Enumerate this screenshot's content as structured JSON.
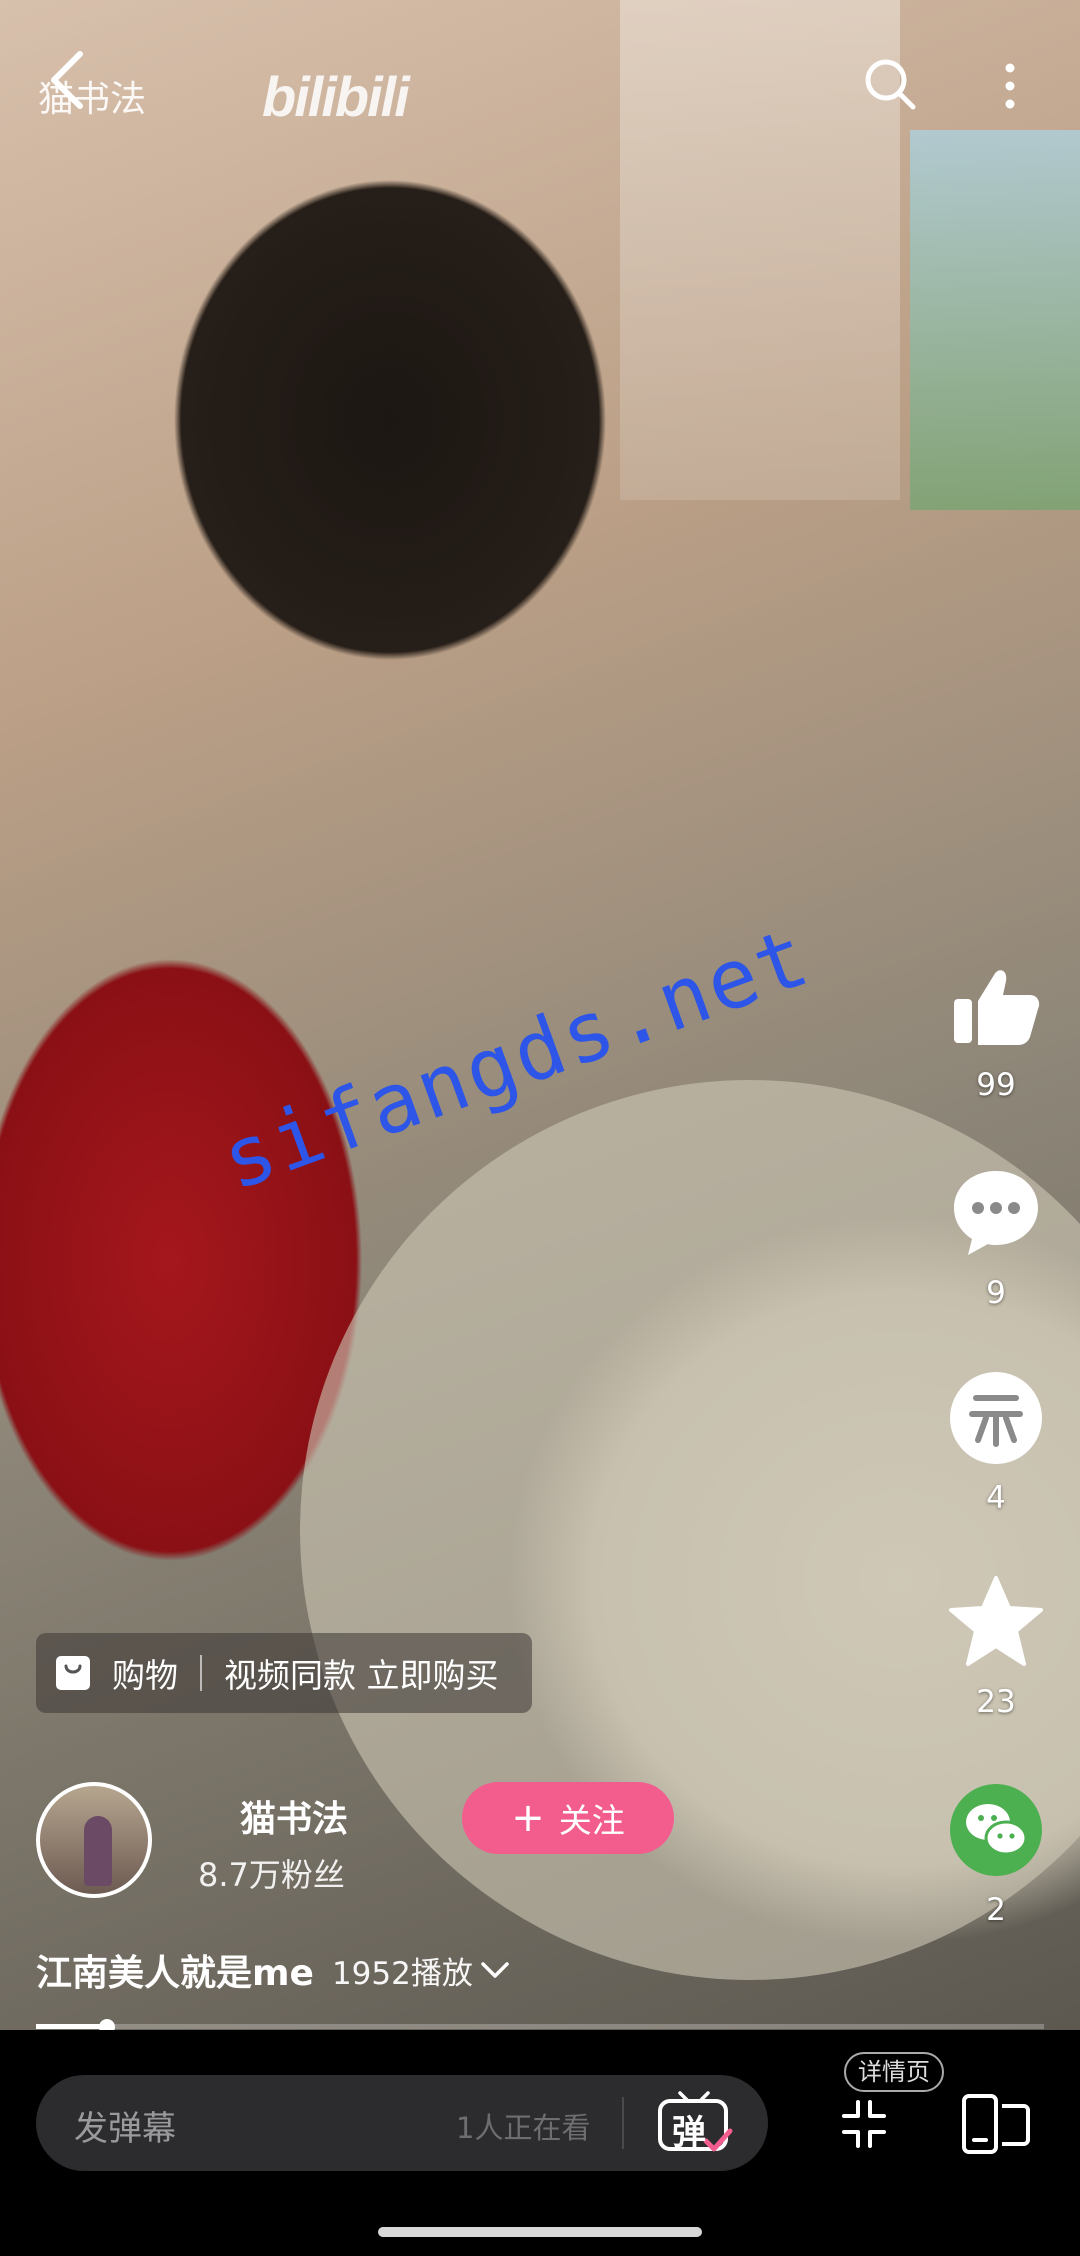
{
  "header": {
    "channel_name": "猫书法",
    "brand": "bilibili",
    "back_icon": "chevron-left-icon",
    "search_icon": "search-icon",
    "more_icon": "more-vertical-icon"
  },
  "watermark": "sifangds.net",
  "actions": {
    "like": {
      "icon": "thumbs-up-icon",
      "count": "99"
    },
    "comment": {
      "icon": "comment-bubble-icon",
      "count": "9"
    },
    "coin": {
      "icon": "coin-icon",
      "count": "4"
    },
    "favorite": {
      "icon": "star-icon",
      "count": "23"
    },
    "share": {
      "icon": "wechat-icon",
      "count": "2",
      "color": "#4CAF50"
    }
  },
  "shop": {
    "label": "购物",
    "promo": "视频同款 立即购买",
    "icon": "shopping-bag-icon"
  },
  "author": {
    "name": "猫书法",
    "fans": "8.7万粉丝",
    "follow_label": "关注",
    "follow_color": "#F25D8E"
  },
  "video": {
    "title": "江南美人就是me",
    "plays": "1952播放",
    "progress_fraction": 0.07
  },
  "bottom_bar": {
    "danmaku_placeholder": "发弹幕",
    "watching": "1人正在看",
    "danmaku_toggle": "弹",
    "detail_label": "详情页",
    "collapse_icon": "collapse-icon",
    "layout_icon": "device-layout-icon"
  }
}
